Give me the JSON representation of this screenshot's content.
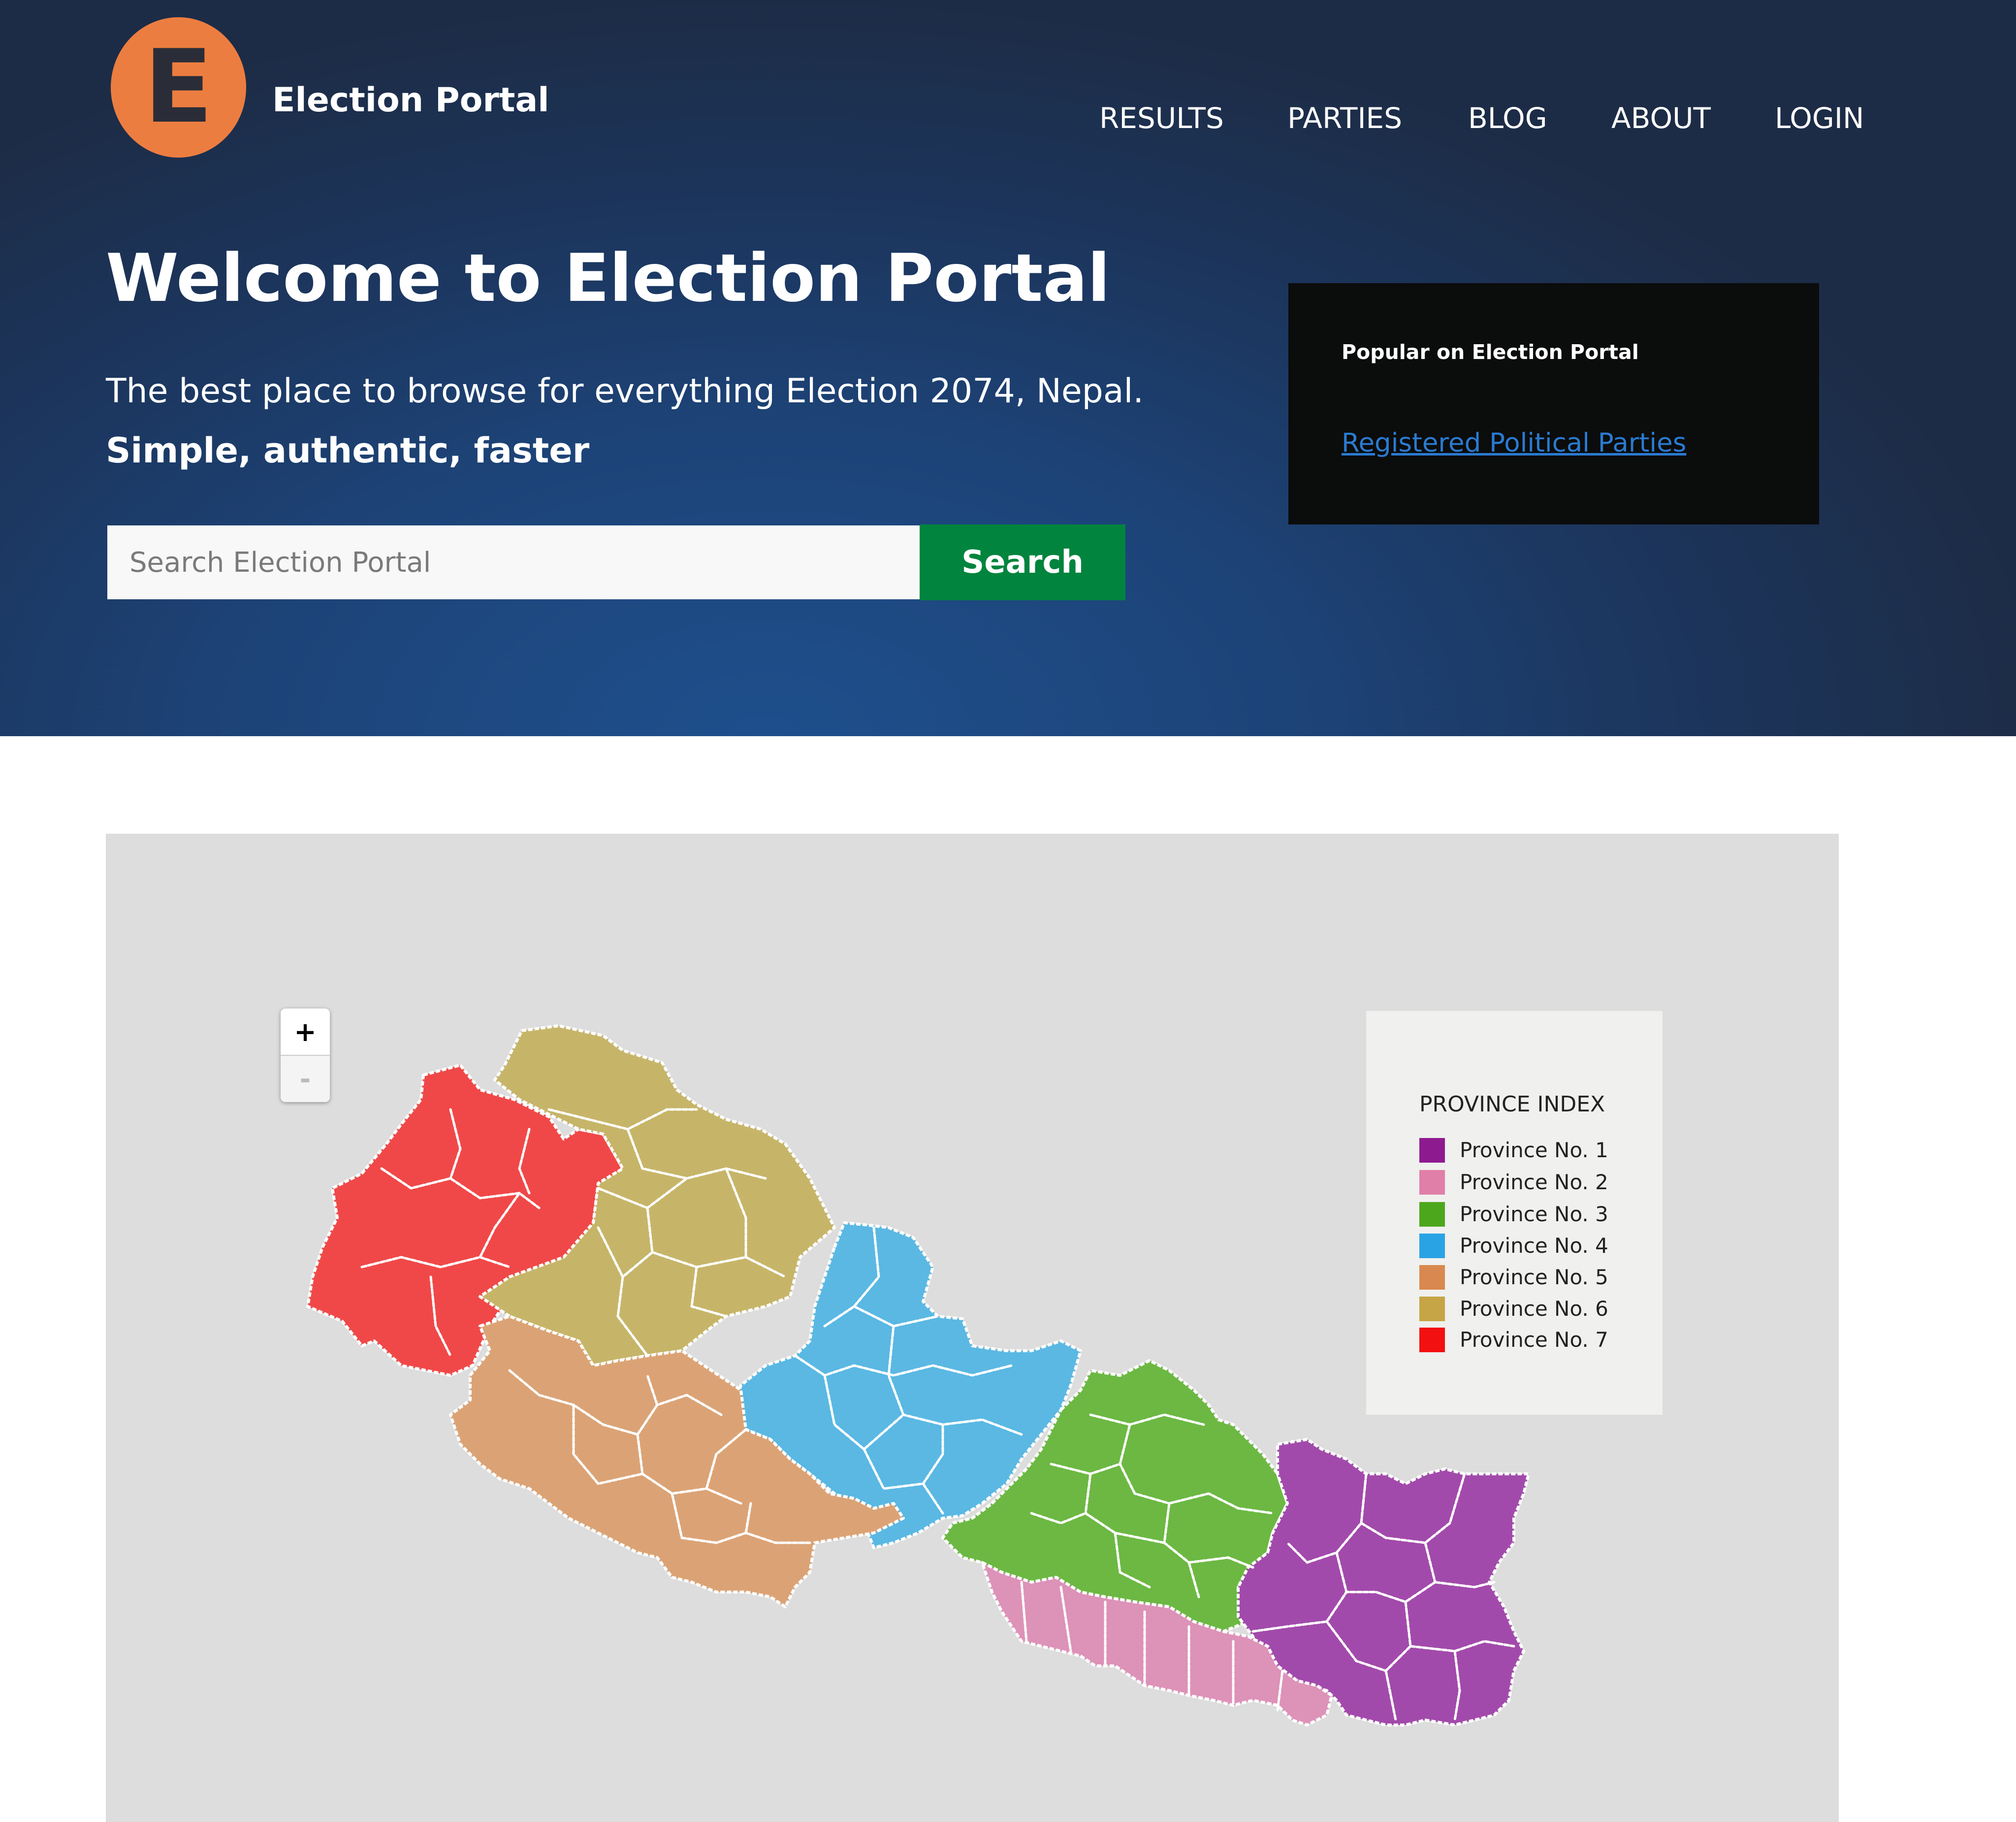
{
  "header": {
    "logo_letter": "E",
    "brand": "Election Portal",
    "nav": [
      "RESULTS",
      "PARTIES",
      "BLOG",
      "ABOUT",
      "LOGIN"
    ]
  },
  "hero": {
    "title": "Welcome to Election Portal",
    "subtitle": "The best place to browse for everything Election 2074, Nepal.",
    "tagline": "Simple, authentic, faster"
  },
  "search": {
    "placeholder": "Search Election Portal",
    "value": "",
    "button_label": "Search"
  },
  "popular": {
    "title": "Popular on Election Portal",
    "links": [
      "Registered Political Parties"
    ]
  },
  "map": {
    "zoom_in_label": "+",
    "zoom_out_label": "-",
    "legend": {
      "title": "PROVINCE INDEX",
      "items": [
        {
          "label": "Province No. 1",
          "color": "#8e1a8f"
        },
        {
          "label": "Province No. 2",
          "color": "#e07fa8"
        },
        {
          "label": "Province No. 3",
          "color": "#4da71c"
        },
        {
          "label": "Province No. 4",
          "color": "#2aa3e5"
        },
        {
          "label": "Province No. 5",
          "color": "#d9894f"
        },
        {
          "label": "Province No. 6",
          "color": "#c5a545"
        },
        {
          "label": "Province No. 7",
          "color": "#f21010"
        }
      ]
    }
  },
  "colors": {
    "hero_dark": "#1d2c46",
    "hero_light": "#1e4f8c",
    "logo": "#ec7d40",
    "search_button": "#00843e",
    "popular_box": "#0b0c0c",
    "link": "#2a7bd1",
    "map_background": "#dddddd",
    "map_fill": {
      "province_1": "#a24aab",
      "province_2": "#dd92b8",
      "province_3": "#6cb843",
      "province_4": "#5ab8e3",
      "province_5": "#dba375",
      "province_6": "#c6b569",
      "province_7": "#f04848"
    }
  }
}
